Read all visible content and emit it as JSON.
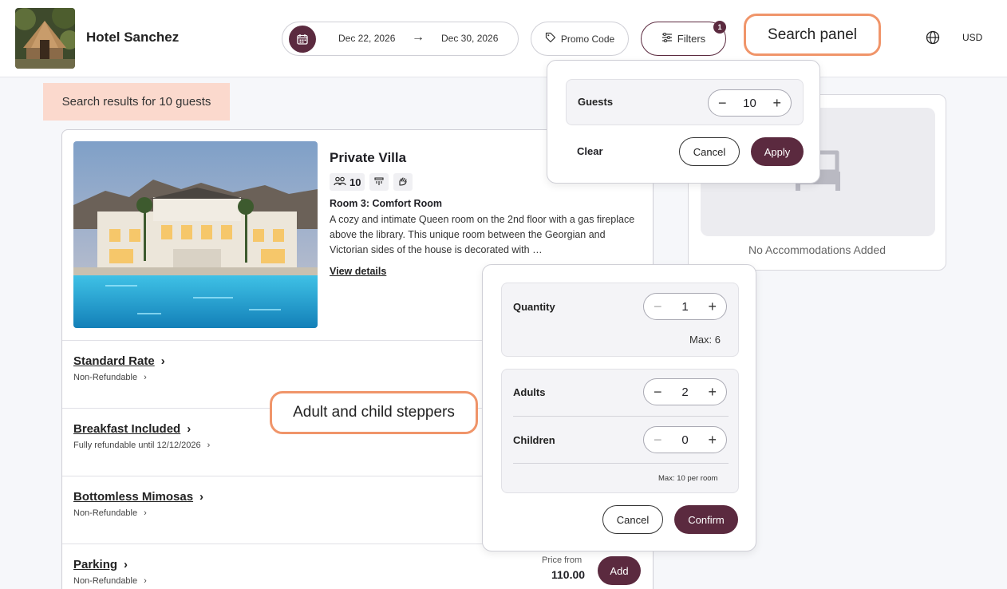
{
  "header": {
    "hotel_name": "Hotel Sanchez",
    "check_in": "Dec 22, 2026",
    "check_out": "Dec 30, 2026",
    "promo_label": "Promo Code",
    "filters_label": "Filters",
    "filters_count": "1",
    "currency": "USD"
  },
  "annotations": {
    "search_panel": "Search panel",
    "steppers": "Adult and child steppers"
  },
  "results_banner": "Search results for 10 guests",
  "room": {
    "title": "Private Villa",
    "guest_capacity": "10",
    "subtitle": "Room 3: Comfort Room",
    "description": "A cozy and intimate Queen room on the 2nd floor with a gas fireplace above the library. This unique room between the Georgian and Victorian sides of the house is decorated with …",
    "view_details": "View details"
  },
  "rates": [
    {
      "name": "Standard Rate",
      "policy": "Non-Refundable"
    },
    {
      "name": "Breakfast Included",
      "policy": "Fully refundable until 12/12/2026"
    },
    {
      "name": "Bottomless Mimosas",
      "policy": "Non-Refundable"
    },
    {
      "name": "Parking",
      "policy": "Non-Refundable",
      "price_label": "Price from",
      "price": "110.00",
      "add_label": "Add"
    }
  ],
  "summary": {
    "empty_text": "No Accommodations Added"
  },
  "guests_panel": {
    "label": "Guests",
    "value": "10",
    "clear_label": "Clear",
    "cancel_label": "Cancel",
    "apply_label": "Apply"
  },
  "quantity_panel": {
    "quantity_label": "Quantity",
    "quantity_value": "1",
    "quantity_max": "Max: 6",
    "adults_label": "Adults",
    "adults_value": "2",
    "children_label": "Children",
    "children_value": "0",
    "occupancy_max": "Max: 10 per room",
    "cancel_label": "Cancel",
    "confirm_label": "Confirm"
  },
  "symbols": {
    "minus": "−",
    "plus": "+",
    "arrow": "→",
    "chevron": "›"
  },
  "colors": {
    "brand": "#5b2a3f",
    "callout_border": "#f0956a",
    "banner_bg": "#fbd9cd"
  }
}
